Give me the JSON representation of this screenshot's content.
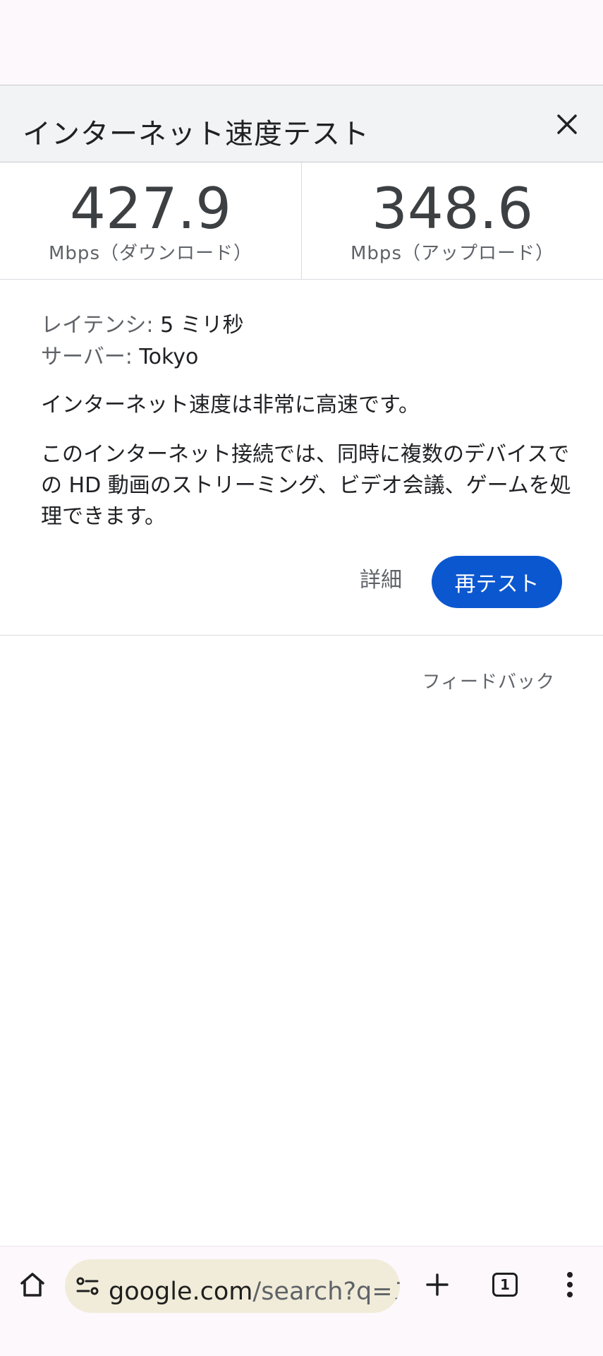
{
  "dialog": {
    "title": "インターネット速度テスト"
  },
  "results": {
    "download": {
      "value": "427.9",
      "unit": "Mbps（ダウンロード）"
    },
    "upload": {
      "value": "348.6",
      "unit": "Mbps（アップロード）"
    }
  },
  "info": {
    "latency_label": "レイテンシ:",
    "latency_value": "5 ミリ秒",
    "server_label": "サーバー:",
    "server_value": "Tokyo",
    "summary": "インターネット速度は非常に高速です。",
    "description": "このインターネット接続では、同時に複数のデバイスでの HD 動画のストリーミング、ビデオ会議、ゲームを処理できます。"
  },
  "actions": {
    "details_label": "詳細",
    "retest_label": "再テスト",
    "feedback_label": "フィードバック"
  },
  "browser": {
    "url_domain": "google.com",
    "url_rest": "/search?q=スピ",
    "tab_count": "1"
  },
  "icons": {
    "close": "close-icon",
    "home": "home-icon",
    "site_settings": "tune-icon",
    "new_tab": "plus-icon",
    "tabs": "tab-switcher-icon",
    "menu": "more-vert-icon"
  },
  "colors": {
    "accent": "#0b57d0",
    "header_bg": "#f1f3f4",
    "omnibox_bg": "#f1ecd9"
  }
}
